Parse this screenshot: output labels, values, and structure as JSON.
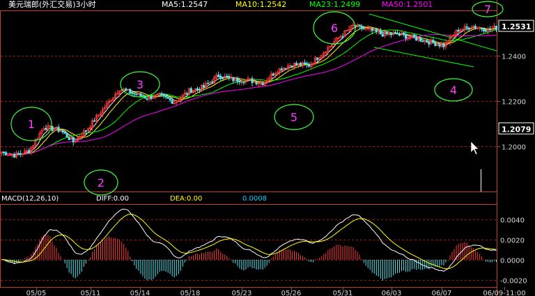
{
  "window": {
    "title": "美元瑞郎(外汇交易)3小时"
  },
  "indicators": {
    "ma5": "MA5:1.2547",
    "ma10": "MA10:1.2542",
    "ma23": "MA23:1.2499",
    "ma50": "MA50:1.2501"
  },
  "macd": {
    "label": "MACD(12,26,10)",
    "diff": "DIFF:0.00",
    "dea": "DEA:0.00",
    "value": "0.0008"
  },
  "colors": {
    "background": "#000000",
    "border": "#c0402a",
    "grid": "#a01818",
    "up": "#ff3a3a",
    "down": "#54e7ee",
    "ma5": "#ffffff",
    "ma10": "#ffff00",
    "ma23": "#00ff00",
    "ma50": "#ff00ff",
    "annotation_circle": "#3cff3c",
    "annotation_mark": "#ff40ff",
    "axis_text": "#d8d8d8"
  },
  "annotations": [
    "1",
    "2",
    "3",
    "4",
    "5",
    "6",
    "7"
  ],
  "chart_data": [
    {
      "type": "candlestick",
      "title": "美元瑞郎(外汇交易)3小时",
      "y_ticks": [
        1.2,
        1.22,
        1.24
      ],
      "y_tick_labels": [
        "1.2000",
        "1.2200",
        "1.2400"
      ],
      "ylim": [
        1.18,
        1.26
      ],
      "current_price": "1.2079",
      "last_price": "1.2531",
      "x_tick_labels": [
        "05/05",
        "05/11",
        "05/14",
        "05/18",
        "05/23",
        "05/26",
        "05/31",
        "06/03",
        "06/07",
        "06/09-11:00"
      ],
      "anchors": [
        [
          0,
          1.1975
        ],
        [
          6,
          1.196
        ],
        [
          13,
          1.198
        ],
        [
          20,
          1.2085
        ],
        [
          28,
          1.207
        ],
        [
          34,
          1.202
        ],
        [
          40,
          1.207
        ],
        [
          47,
          1.215
        ],
        [
          56,
          1.2255
        ],
        [
          62,
          1.2235
        ],
        [
          69,
          1.2215
        ],
        [
          75,
          1.2225
        ],
        [
          82,
          1.2195
        ],
        [
          89,
          1.2245
        ],
        [
          96,
          1.2262
        ],
        [
          103,
          1.2312
        ],
        [
          110,
          1.2295
        ],
        [
          117,
          1.2292
        ],
        [
          124,
          1.228
        ],
        [
          131,
          1.2338
        ],
        [
          138,
          1.2362
        ],
        [
          146,
          1.2358
        ],
        [
          153,
          1.2418
        ],
        [
          160,
          1.2478
        ],
        [
          167,
          1.2532
        ],
        [
          174,
          1.2515
        ],
        [
          181,
          1.2495
        ],
        [
          188,
          1.2495
        ],
        [
          196,
          1.2478
        ],
        [
          203,
          1.2462
        ],
        [
          210,
          1.2445
        ],
        [
          217,
          1.2515
        ],
        [
          224,
          1.253
        ],
        [
          231,
          1.2515
        ]
      ],
      "legend": [
        "MA5",
        "MA10",
        "MA23",
        "MA50"
      ]
    },
    {
      "type": "bar",
      "title": "MACD(12,26,10)",
      "y_ticks": [
        -0.002,
        0,
        0.002,
        0.004
      ],
      "y_tick_labels": [
        "-0.0020",
        "0.0000",
        "0.0020",
        "0.0040"
      ],
      "ylim": [
        -0.0027,
        0.0055
      ],
      "series": [
        {
          "name": "DIFF",
          "color": "#ffffff"
        },
        {
          "name": "DEA",
          "color": "#ffff00"
        }
      ]
    }
  ]
}
